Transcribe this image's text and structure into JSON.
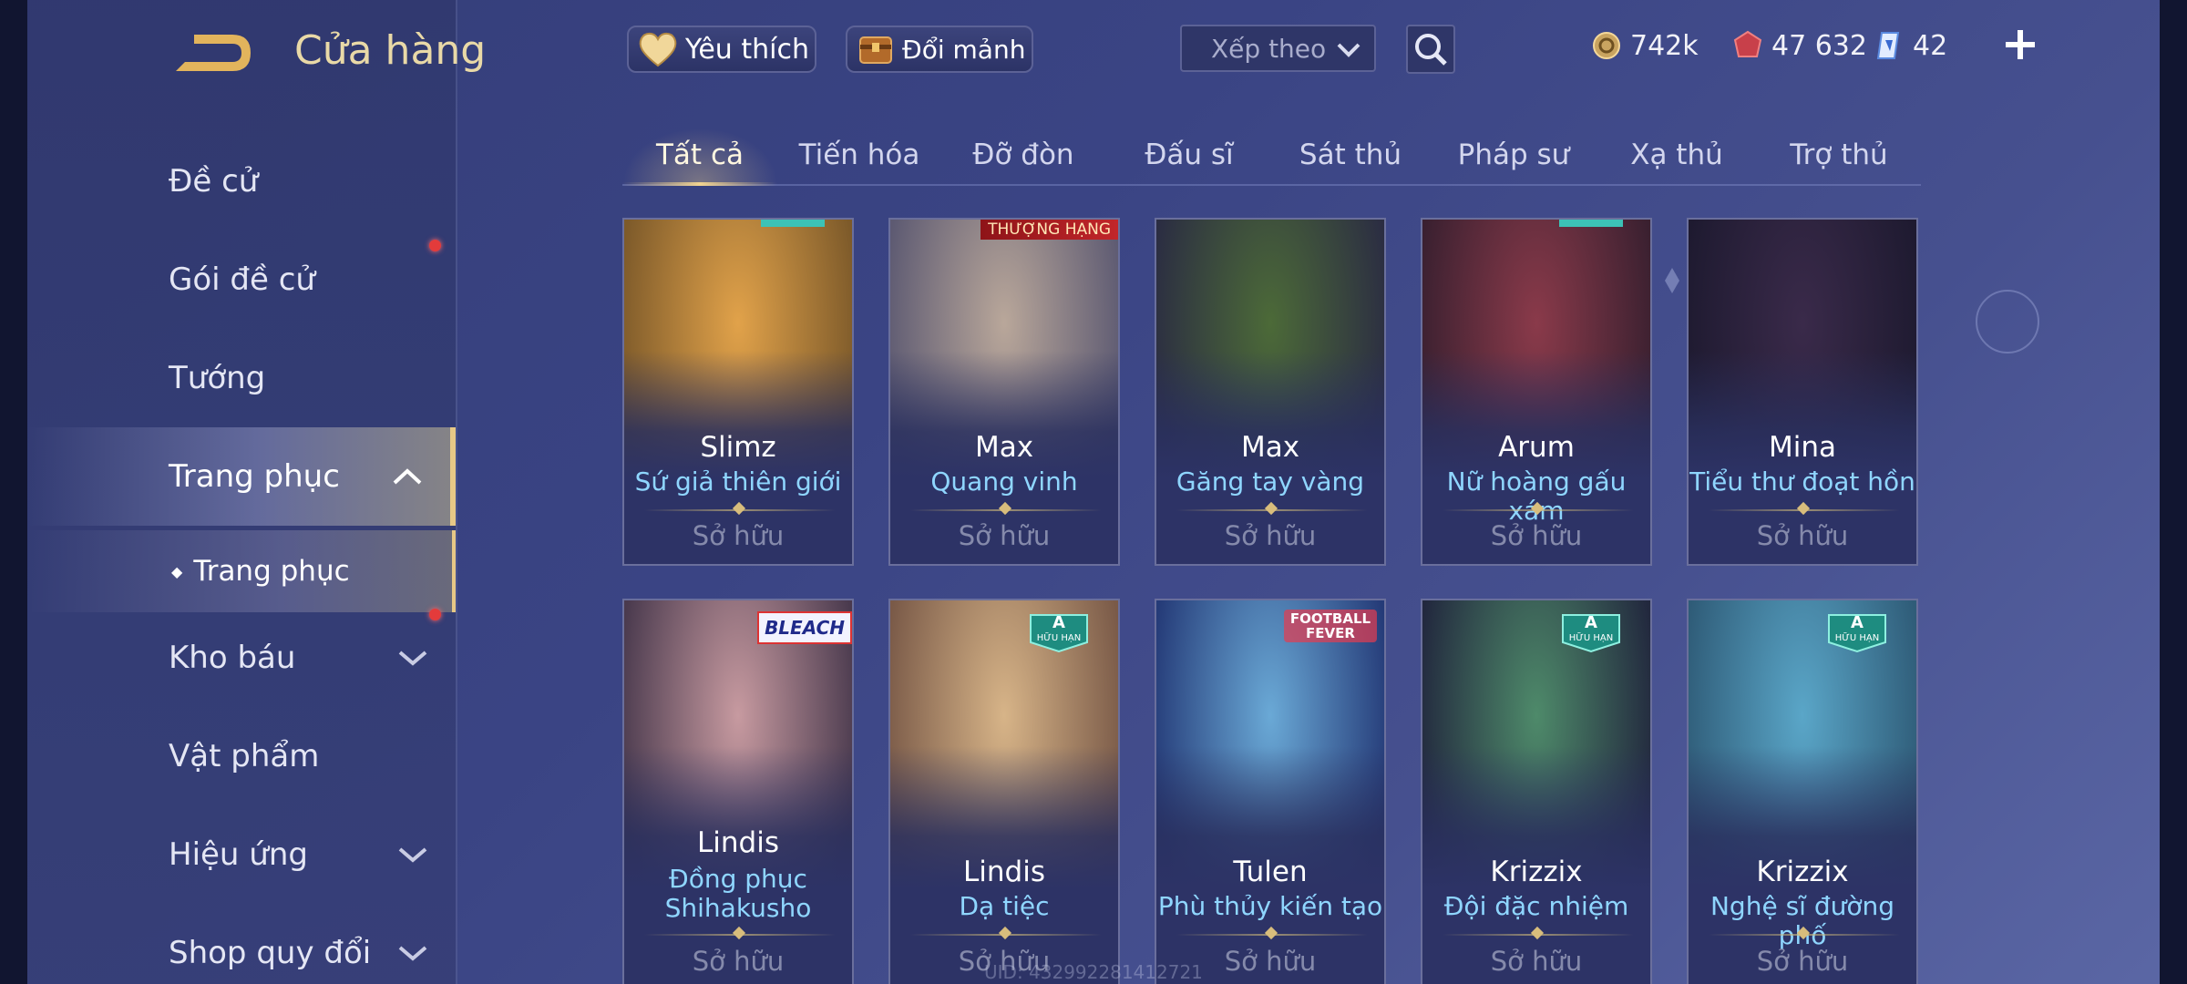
{
  "header": {
    "title": "Cửa hàng",
    "favorites_label": "Yêu thích",
    "exchange_label": "Đổi mảnh",
    "sort_placeholder": "Xếp theo"
  },
  "currencies": {
    "gold": "742k",
    "vouchers": "47 632",
    "gems": "42"
  },
  "sidebar": {
    "items": [
      {
        "label": "Đề cử"
      },
      {
        "label": "Gói đề cử",
        "notification": true
      },
      {
        "label": "Tướng"
      },
      {
        "label": "Trang phục",
        "active": true,
        "expanded": true
      },
      {
        "label": "Kho báu",
        "notification": true
      },
      {
        "label": "Vật phẩm"
      },
      {
        "label": "Hiệu ứng"
      },
      {
        "label": "Shop quy đổi"
      }
    ],
    "sub_item": "Trang phục"
  },
  "tabs": [
    {
      "label": "Tất cả",
      "active": true
    },
    {
      "label": "Tiến hóa"
    },
    {
      "label": "Đỡ đòn"
    },
    {
      "label": "Đấu sĩ"
    },
    {
      "label": "Sát thủ"
    },
    {
      "label": "Pháp sư"
    },
    {
      "label": "Xạ thủ"
    },
    {
      "label": "Trợ thủ"
    }
  ],
  "owned_label": "Sở hữu",
  "skins": [
    {
      "hero": "Slimz",
      "skin": "Sứ giả thiên giới",
      "status": "Sở hữu",
      "colors": [
        "#e1a24a",
        "#7d5a2a"
      ]
    },
    {
      "hero": "Max",
      "skin": "Quang vinh",
      "status": "Sở hữu",
      "badge": "THƯỢNG HẠNG",
      "colors": [
        "#b9a79a",
        "#5d5a72"
      ]
    },
    {
      "hero": "Max",
      "skin": "Găng tay vàng",
      "status": "Sở hữu",
      "colors": [
        "#4c6a38",
        "#2b2d42"
      ]
    },
    {
      "hero": "Arum",
      "skin": "Nữ hoàng gấu xám",
      "status": "Sở hữu",
      "colors": [
        "#8a3a4a",
        "#3a2030"
      ]
    },
    {
      "hero": "Mina",
      "skin": "Tiểu thư đoạt hồn",
      "status": "Sở hữu",
      "colors": [
        "#3a2a4a",
        "#1e1a30"
      ]
    },
    {
      "hero": "Lindis",
      "skin": "Đồng phục Shihakusho",
      "status": "Sở hữu",
      "badge": "BLEACH",
      "colors": [
        "#c79aa0",
        "#4a3a4e"
      ]
    },
    {
      "hero": "Lindis",
      "skin": "Dạ tiệc",
      "status": "Sở hữu",
      "badge": "A",
      "badge_sub": "HỮU HẠN",
      "colors": [
        "#d7b488",
        "#7a5a48"
      ]
    },
    {
      "hero": "Tulen",
      "skin": "Phù thủy kiến tạo",
      "status": "Sở hữu",
      "badge": "FOOTBALL FEVER",
      "colors": [
        "#6aa9d6",
        "#253b78"
      ]
    },
    {
      "hero": "Krizzix",
      "skin": "Đội đặc nhiệm",
      "status": "Sở hữu",
      "badge": "A",
      "badge_sub": "HỮU HẠN",
      "colors": [
        "#4e8a6a",
        "#22283e"
      ]
    },
    {
      "hero": "Krizzix",
      "skin": "Nghệ sĩ đường phố",
      "status": "Sở hữu",
      "badge": "A",
      "badge_sub": "HỮU HẠN",
      "colors": [
        "#5aa6c8",
        "#2f5c78"
      ]
    }
  ],
  "uid_text": "UID: 432992281412721",
  "accent_color": "#e7c886",
  "skin_name_color": "#8fd6ff"
}
